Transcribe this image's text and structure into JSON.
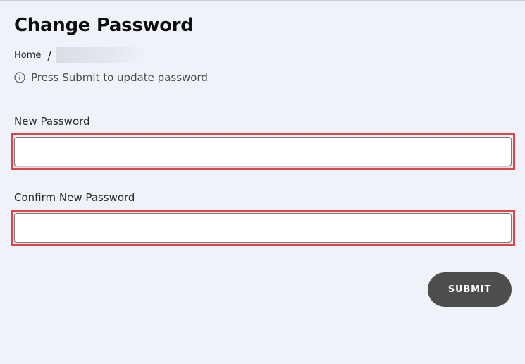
{
  "page": {
    "title": "Change Password"
  },
  "breadcrumb": {
    "home_label": "Home",
    "separator": "/"
  },
  "info": {
    "icon": "info-circle-icon",
    "text": "Press Submit to update password"
  },
  "form": {
    "new_password": {
      "label": "New Password",
      "value": "",
      "placeholder": ""
    },
    "confirm_password": {
      "label": "Confirm New Password",
      "value": "",
      "placeholder": ""
    },
    "submit_label": "SUBMIT"
  },
  "colors": {
    "background": "#eff2f9",
    "highlight_border": "#e0444b",
    "button_bg": "#4d4d4d",
    "button_text": "#ffffff"
  }
}
